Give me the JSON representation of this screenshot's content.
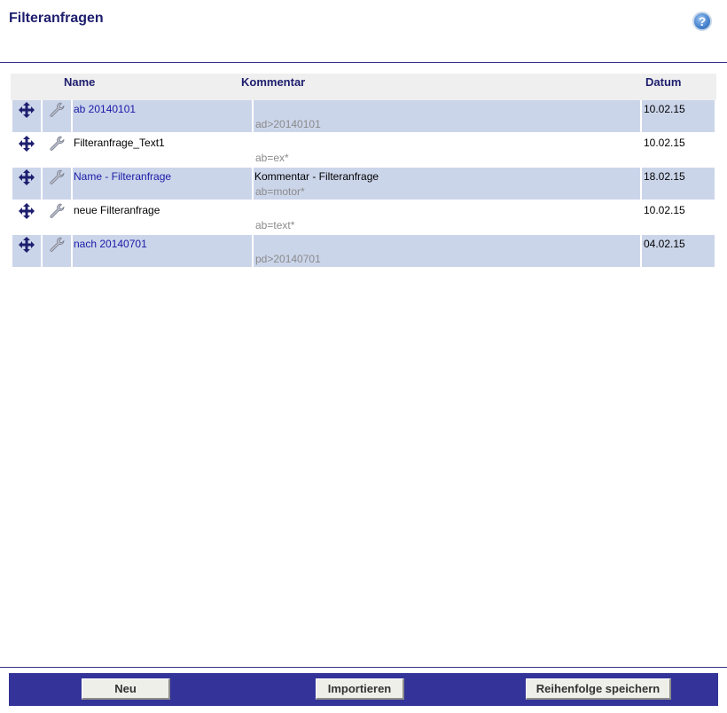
{
  "page": {
    "title": "Filteranfragen",
    "help_label": "?"
  },
  "table": {
    "headers": {
      "name": "Name",
      "comment": "Kommentar",
      "date": "Datum"
    },
    "rows": [
      {
        "name": "ab 20140101",
        "comment": "",
        "filter": "ad>20140101",
        "date": "10.02.15",
        "highlighted": true
      },
      {
        "name": "Filteranfrage_Text1",
        "comment": "",
        "filter": "ab=ex*",
        "date": "10.02.15",
        "highlighted": false
      },
      {
        "name": "Name - Filteranfrage",
        "comment": "Kommentar - Filteranfrage",
        "filter": "ab=motor*",
        "date": "18.02.15",
        "highlighted": true
      },
      {
        "name": "neue Filteranfrage",
        "comment": "",
        "filter": "ab=text*",
        "date": "10.02.15",
        "highlighted": false
      },
      {
        "name": "nach 20140701",
        "comment": "",
        "filter": "pd>20140701",
        "date": "04.02.15",
        "highlighted": true
      }
    ],
    "row_icons": [
      "move-icon",
      "wrench-icon"
    ]
  },
  "footer": {
    "new_label": "Neu",
    "import_label": "Importieren",
    "save_order_label": "Reihenfolge speichern"
  },
  "colors": {
    "title": "#1e1e6e",
    "row_highlight": "#cbd5ea",
    "footer_bar": "#333399",
    "link_text": "#1a1aa6",
    "filter_text": "#8a8a8a"
  }
}
